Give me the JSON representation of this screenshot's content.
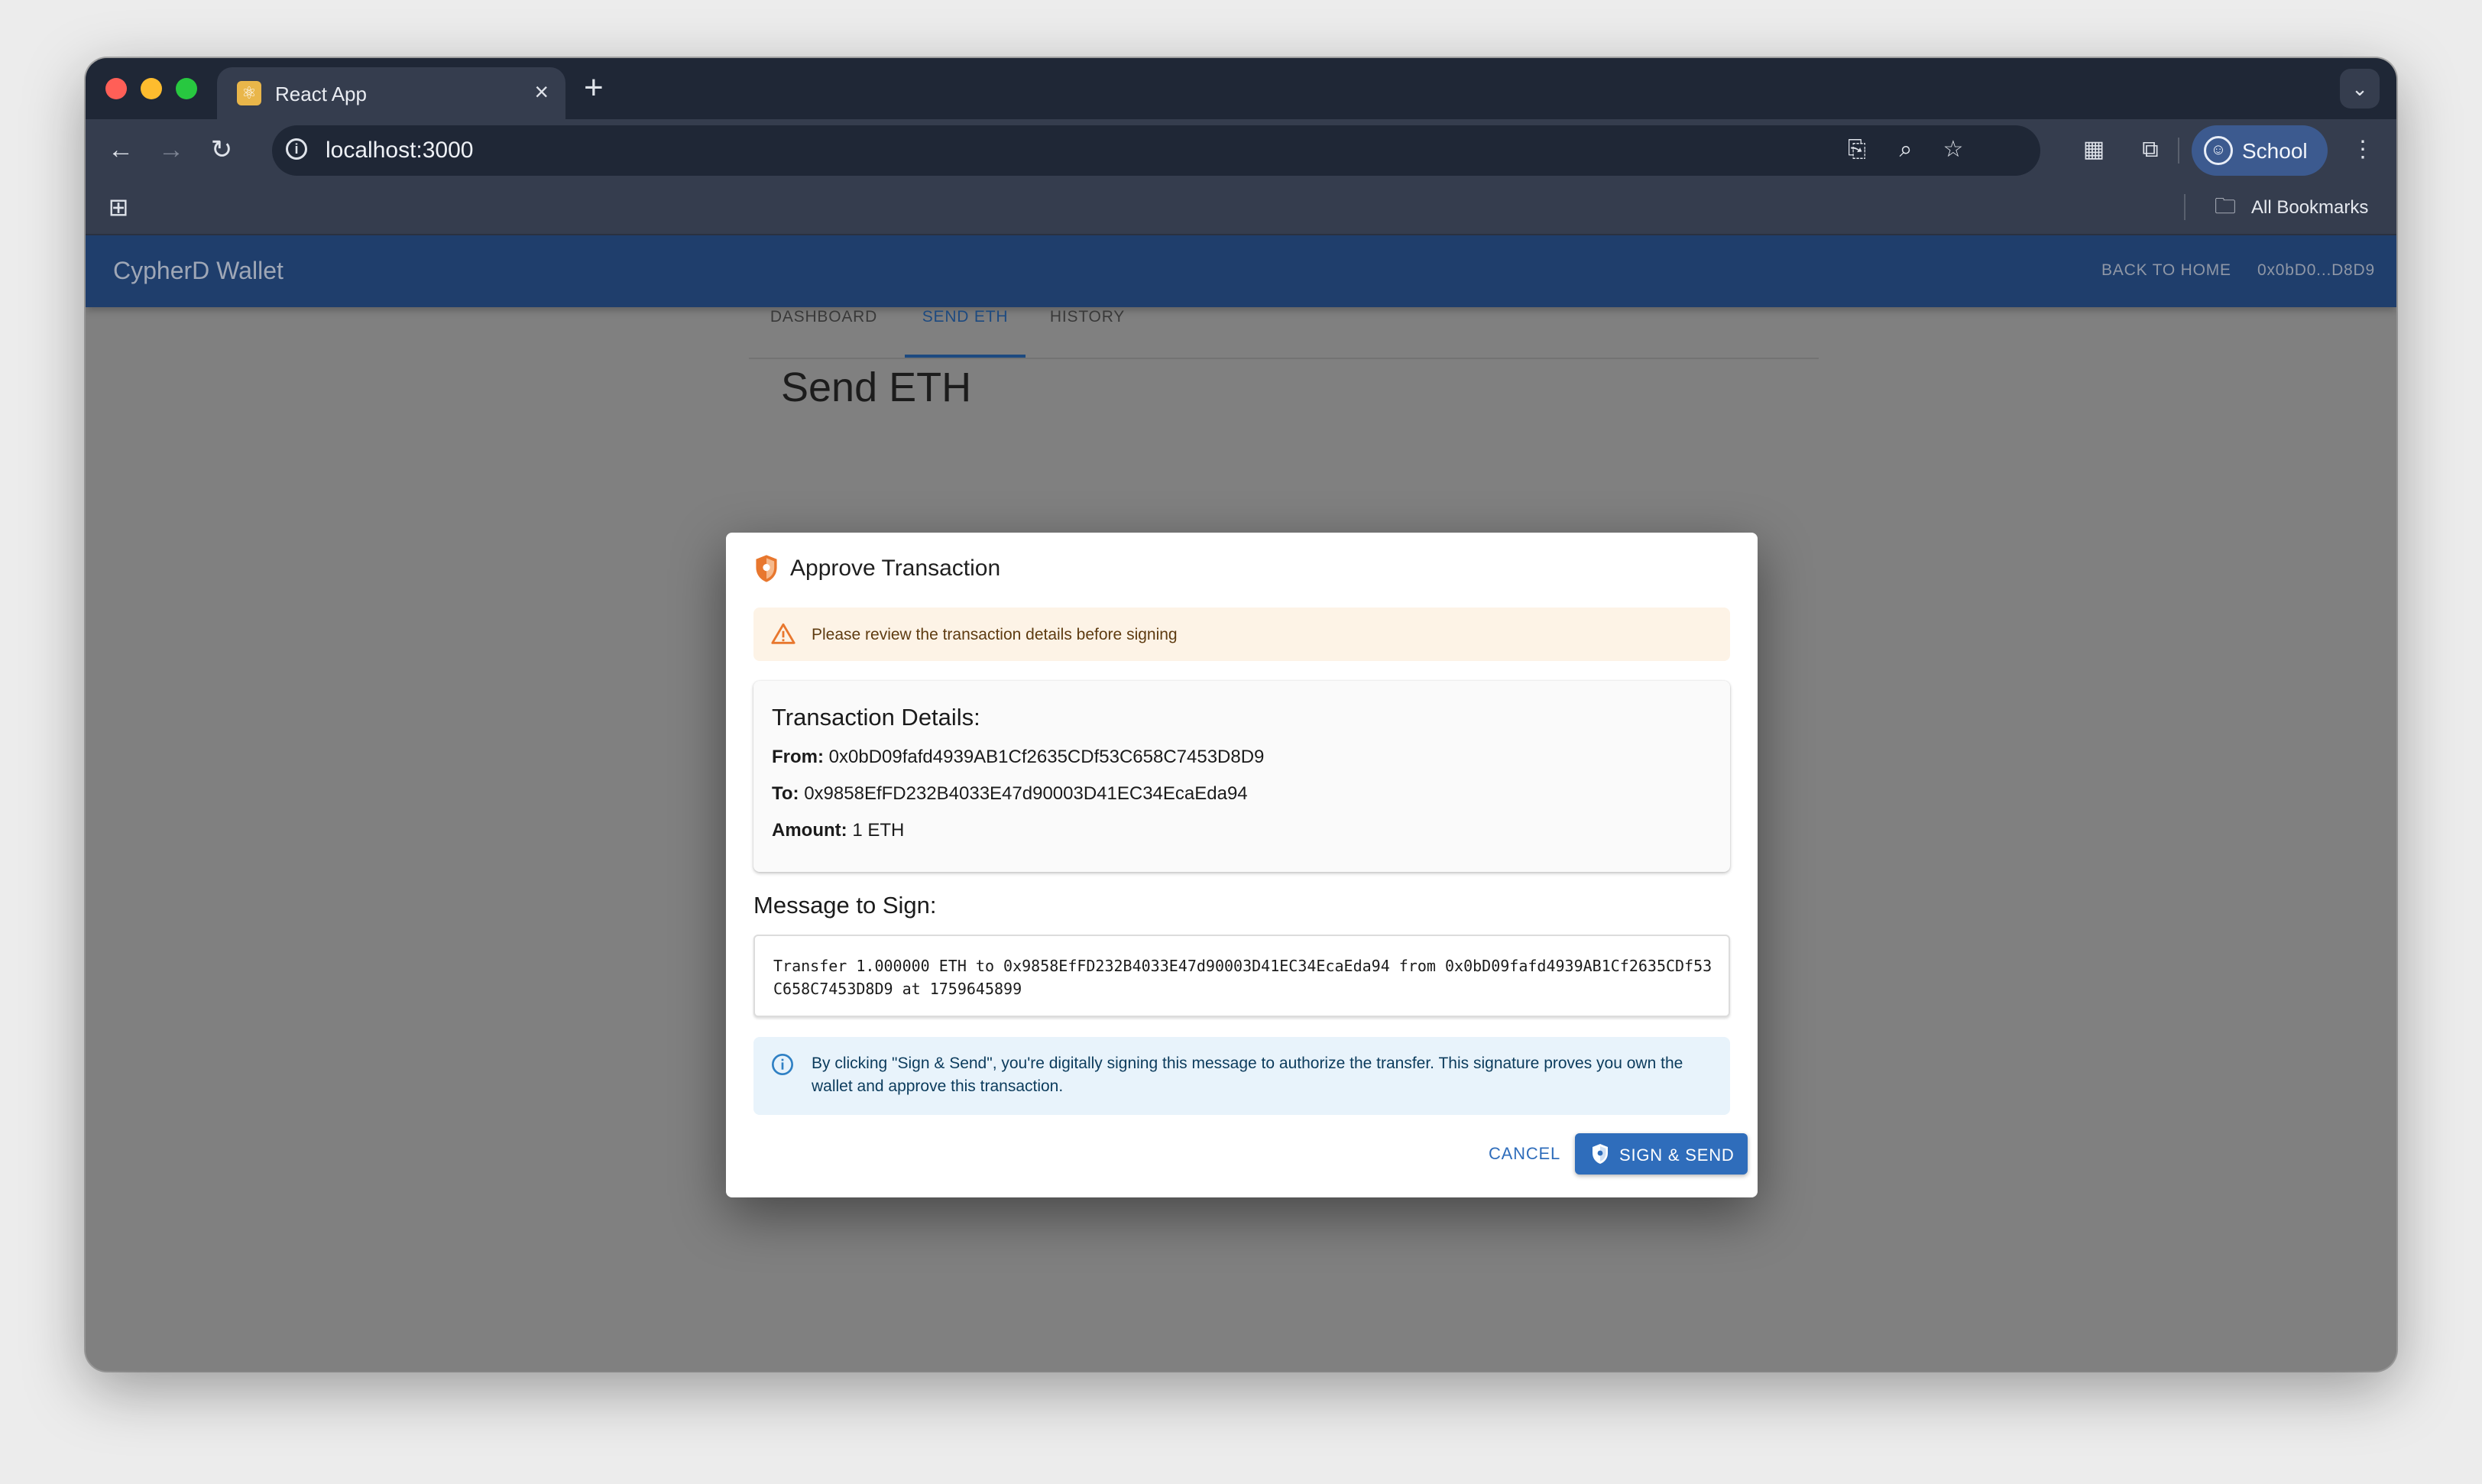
{
  "browser": {
    "tab_title": "React App",
    "url": "localhost:3000",
    "profile_name": "School",
    "all_bookmarks_label": "All Bookmarks"
  },
  "app": {
    "brand": "CypherD Wallet",
    "back_to_home": "BACK TO HOME",
    "short_address": "0x0bD0...D8D9",
    "tabs": [
      "DASHBOARD",
      "SEND ETH",
      "HISTORY"
    ],
    "active_tab": "SEND ETH",
    "page_heading": "Send ETH"
  },
  "dialog": {
    "title": "Approve Transaction",
    "warning": "Please review the transaction details before signing",
    "details_title": "Transaction Details:",
    "from_label": "From:",
    "from_value": "0x0bD09fafd4939AB1Cf2635CDf53C658C7453D8D9",
    "to_label": "To:",
    "to_value": "0x9858EfFD232B4033E47d90003D41EC34EcaEda94",
    "amount_label": "Amount:",
    "amount_value": "1 ETH",
    "message_label": "Message to Sign:",
    "message": "Transfer 1.000000 ETH to 0x9858EfFD232B4033E47d90003D41EC34EcaEda94 from 0x0bD09fafd4939AB1Cf2635CDf53C658C7453D8D9 at 1759645899",
    "info": "By clicking \"Sign & Send\", you're digitally signing this message to authorize the transfer. This signature proves you own the wallet and approve this transaction.",
    "cancel_label": "CANCEL",
    "send_label": "SIGN & SEND"
  },
  "colors": {
    "appbar": "#1f3e6c",
    "primary": "#2f6dbb",
    "warning_icon": "#e8772e",
    "info_icon": "#2f80c4"
  }
}
